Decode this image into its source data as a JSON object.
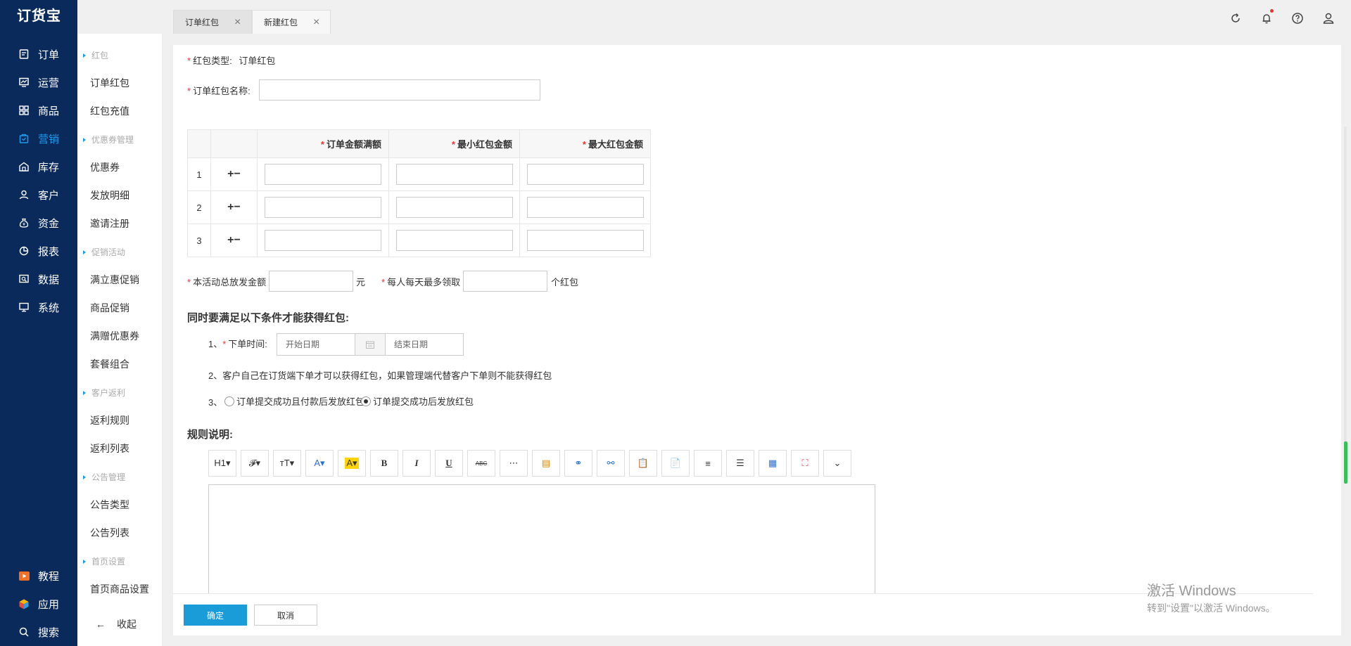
{
  "app": {
    "logo": "订货宝"
  },
  "leftnav": {
    "items": [
      {
        "label": "订单",
        "icon": "order-icon"
      },
      {
        "label": "运营",
        "icon": "operation-icon"
      },
      {
        "label": "商品",
        "icon": "goods-icon"
      },
      {
        "label": "营销",
        "icon": "marketing-icon",
        "active": true
      },
      {
        "label": "库存",
        "icon": "warehouse-icon"
      },
      {
        "label": "客户",
        "icon": "customer-icon"
      },
      {
        "label": "资金",
        "icon": "money-bag-icon"
      },
      {
        "label": "报表",
        "icon": "pie-chart-icon"
      },
      {
        "label": "数据",
        "icon": "data-icon"
      },
      {
        "label": "系统",
        "icon": "monitor-icon"
      }
    ],
    "bottom": [
      {
        "label": "教程",
        "icon": "play-icon"
      },
      {
        "label": "应用",
        "icon": "cube-icon"
      },
      {
        "label": "搜索",
        "icon": "search-icon"
      }
    ]
  },
  "subnav": {
    "groups": [
      {
        "title": "红包",
        "items": [
          "订单红包",
          "红包充值"
        ]
      },
      {
        "title": "优惠券管理",
        "items": [
          "优惠券",
          "发放明细",
          "邀请注册"
        ]
      },
      {
        "title": "促销活动",
        "items": [
          "满立惠促销",
          "商品促销",
          "满赠优惠券",
          "套餐组合"
        ]
      },
      {
        "title": "客户返利",
        "items": [
          "返利规则",
          "返利列表"
        ]
      },
      {
        "title": "公告管理",
        "items": [
          "公告类型",
          "公告列表"
        ]
      },
      {
        "title": "首页设置",
        "items": [
          "首页商品设置"
        ]
      }
    ],
    "collapse_arrow": "←",
    "collapse_label": "收起"
  },
  "tabs": [
    {
      "label": "订单红包",
      "active": false
    },
    {
      "label": "新建红包",
      "active": true
    }
  ],
  "topbar": {
    "icons": [
      "refresh-icon",
      "bell-icon",
      "help-icon",
      "user-icon"
    ],
    "notification_dot_color": "#e33333"
  },
  "form": {
    "type_label": "红包类型:",
    "type_value": "订单红包",
    "name_label": "订单红包名称:",
    "name_value": "",
    "table": {
      "headers": [
        "订单金额满额",
        "最小红包金额",
        "最大红包金额"
      ],
      "rows": [
        {
          "num": "1",
          "plus": "+",
          "minus": "−"
        },
        {
          "num": "2",
          "plus": "+",
          "minus": "−"
        },
        {
          "num": "3",
          "plus": "+",
          "minus": "−"
        }
      ]
    },
    "total_label": "本活动总放发金额",
    "total_unit": "元",
    "daily_label": "每人每天最多领取",
    "daily_unit": "个红包",
    "conditions_title": "同时要满足以下条件才能获得红包:",
    "cond1_prefix": "1、",
    "cond1_label": "下单时间:",
    "start_placeholder": "开始日期",
    "end_placeholder": "结束日期",
    "cond2": "2、客户自己在订货端下单才可以获得红包，如果管理端代替客户下单则不能获得红包",
    "cond3_prefix": "3、",
    "radio1": "订单提交成功且付款后发放红包",
    "radio2": "订单提交成功后发放红包",
    "radio_selected": 2,
    "rules_title": "规则说明:",
    "toolbar": [
      {
        "name": "heading",
        "label": "H1▾"
      },
      {
        "name": "font-family",
        "label": "𝓕▾"
      },
      {
        "name": "font-size",
        "label": "тT▾"
      },
      {
        "name": "font-color",
        "label": "A▾"
      },
      {
        "name": "bg-color",
        "label": "A▾"
      },
      {
        "name": "bold",
        "label": "B"
      },
      {
        "name": "italic",
        "label": "I"
      },
      {
        "name": "underline",
        "label": "U"
      },
      {
        "name": "strikethrough",
        "label": "ABC"
      },
      {
        "name": "table",
        "label": "⋯"
      },
      {
        "name": "insert",
        "label": "▤"
      },
      {
        "name": "link",
        "label": "⚭"
      },
      {
        "name": "unlink",
        "label": "⚯"
      },
      {
        "name": "paste",
        "label": "📋"
      },
      {
        "name": "paste-text",
        "label": "📄"
      },
      {
        "name": "ordered-list",
        "label": "≡"
      },
      {
        "name": "unordered-list",
        "label": "☰"
      },
      {
        "name": "table-insert",
        "label": "▦"
      },
      {
        "name": "fullscreen",
        "label": "⛶"
      },
      {
        "name": "more",
        "label": "⌄"
      }
    ]
  },
  "footer": {
    "confirm": "确定",
    "cancel": "取消"
  },
  "watermark": {
    "line1": "激活 Windows",
    "line2": "转到\"设置\"以激活 Windows。"
  },
  "colors": {
    "sidebar": "#0a2a5c",
    "accent": "#1a9cf0",
    "primary_button": "#1a9cd8",
    "required": "#e33333"
  }
}
